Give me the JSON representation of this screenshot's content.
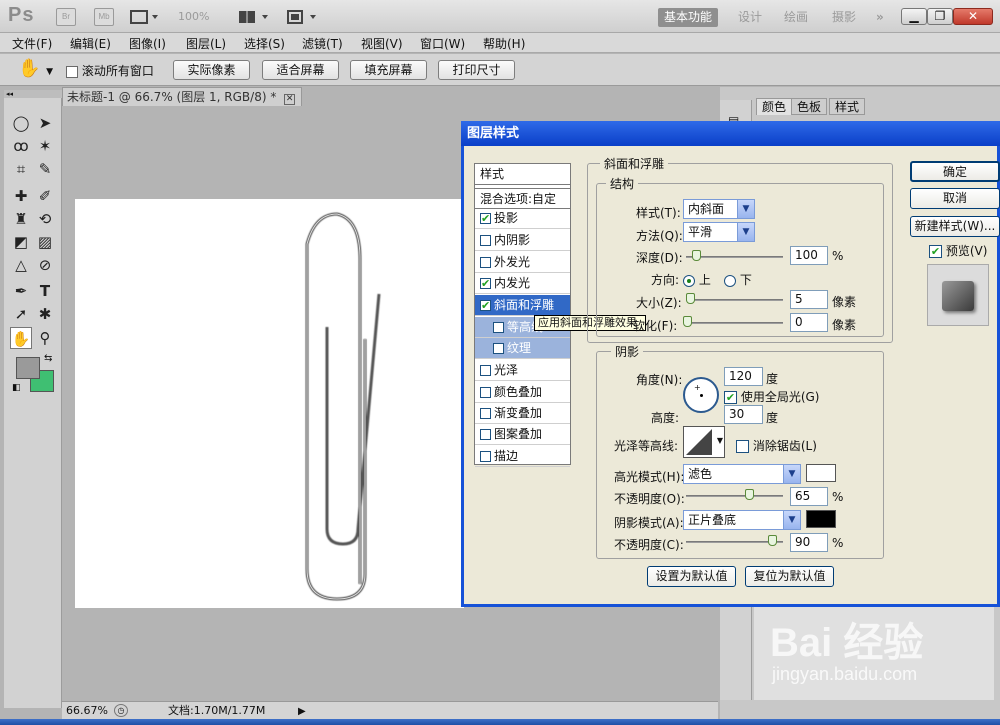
{
  "app": {
    "logo": "Ps",
    "icons": {
      "bridge": "Br",
      "mini_bridge": "Mb"
    },
    "zoom": "100%",
    "workspaces": [
      "基本功能",
      "设计",
      "绘画",
      "摄影"
    ],
    "more": "»"
  },
  "menu": [
    "文件(F)",
    "编辑(E)",
    "图像(I)",
    "图层(L)",
    "选择(S)",
    "滤镜(T)",
    "视图(V)",
    "窗口(W)",
    "帮助(H)"
  ],
  "options": {
    "scroll_all": "滚动所有窗口",
    "buttons": [
      "实际像素",
      "适合屏幕",
      "填充屏幕",
      "打印尺寸"
    ]
  },
  "document": {
    "tab_title": "未标题-1 @ 66.7% (图层 1, RGB/8) *",
    "zoom": "66.67%",
    "doc_info": "文档:1.70M/1.77M"
  },
  "panels": {
    "tabs": [
      "颜色",
      "色板",
      "样式"
    ]
  },
  "dialog": {
    "title": "图层样式",
    "styles_header": "样式",
    "blend_options": "混合选项:自定",
    "styles": [
      {
        "label": "投影",
        "checked": true
      },
      {
        "label": "内阴影",
        "checked": false
      },
      {
        "label": "外发光",
        "checked": false
      },
      {
        "label": "内发光",
        "checked": true
      },
      {
        "label": "斜面和浮雕",
        "checked": true
      },
      {
        "label": "等高线",
        "checked": false
      },
      {
        "label": "纹理",
        "checked": false
      },
      {
        "label": "光泽",
        "checked": false
      },
      {
        "label": "颜色叠加",
        "checked": false
      },
      {
        "label": "渐变叠加",
        "checked": false
      },
      {
        "label": "图案叠加",
        "checked": false
      },
      {
        "label": "描边",
        "checked": false
      }
    ],
    "tooltip": "应用斜面和浮雕效果",
    "bevel": {
      "section": "斜面和浮雕",
      "structure": "结构",
      "style_label": "样式(T):",
      "style_value": "内斜面",
      "technique_label": "方法(Q):",
      "technique_value": "平滑",
      "depth_label": "深度(D):",
      "depth": "100",
      "depth_unit": "%",
      "depth_level": 0.1,
      "direction_label": "方向:",
      "dir_up": "上",
      "dir_down": "下",
      "size_label": "大小(Z):",
      "size": "5",
      "size_unit": "像素",
      "soften_label": "软化(F):",
      "soften": "0",
      "soften_unit": "像素",
      "shading": "阴影",
      "angle_label": "角度(N):",
      "angle": "120",
      "angle_unit": "度",
      "global_light": "使用全局光(G)",
      "altitude_label": "高度:",
      "altitude": "30",
      "altitude_unit": "度",
      "gloss_label": "光泽等高线:",
      "anti_alias": "消除锯齿(L)",
      "highlight_mode_label": "高光模式(H):",
      "highlight_mode": "滤色",
      "highlight_color": "#ffffff",
      "highlight_opacity_label": "不透明度(O):",
      "highlight_opacity": "65",
      "shadow_mode_label": "阴影模式(A):",
      "shadow_mode": "正片叠底",
      "shadow_color": "#000000",
      "shadow_opacity_label": "不透明度(C):",
      "shadow_opacity": "90",
      "percent": "%",
      "make_default": "设置为默认值",
      "reset_default": "复位为默认值"
    },
    "buttons": {
      "ok": "确定",
      "cancel": "取消",
      "new_style": "新建样式(W)...",
      "preview": "预览(V)"
    }
  },
  "watermark": {
    "logo": "Bai 经验",
    "url": "jingyan.baidu.com"
  },
  "colors": {
    "foreground": "#9a9a9a",
    "background": "#3fbf72",
    "accent": "#1652d8"
  }
}
